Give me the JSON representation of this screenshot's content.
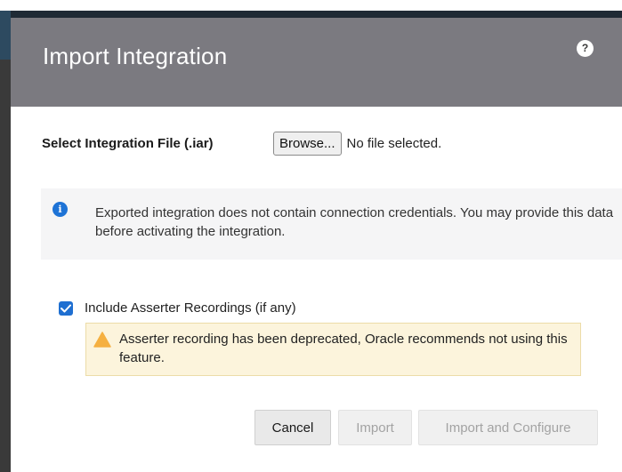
{
  "dialog": {
    "title": "Import Integration",
    "help_label": "?"
  },
  "file": {
    "label": "Select Integration File (.iar)",
    "browse_label": "Browse...",
    "status": "No file selected."
  },
  "info": {
    "icon": "info-icon",
    "text": "Exported integration does not contain connection credentials. You may provide this data before activating the integration."
  },
  "asserter": {
    "checked": true,
    "label": "Include Asserter Recordings (if any)",
    "warning_text": "Asserter recording has been deprecated, Oracle recommends not using this feature."
  },
  "footer": {
    "cancel_label": "Cancel",
    "import_label": "Import",
    "import_configure_label": "Import and Configure"
  },
  "colors": {
    "header_bg": "#7b7a80",
    "checkbox": "#1f6fd1",
    "info_icon": "#1e73d6",
    "warning_bg": "#fcf4dc",
    "warning_icon": "#f5b041"
  }
}
